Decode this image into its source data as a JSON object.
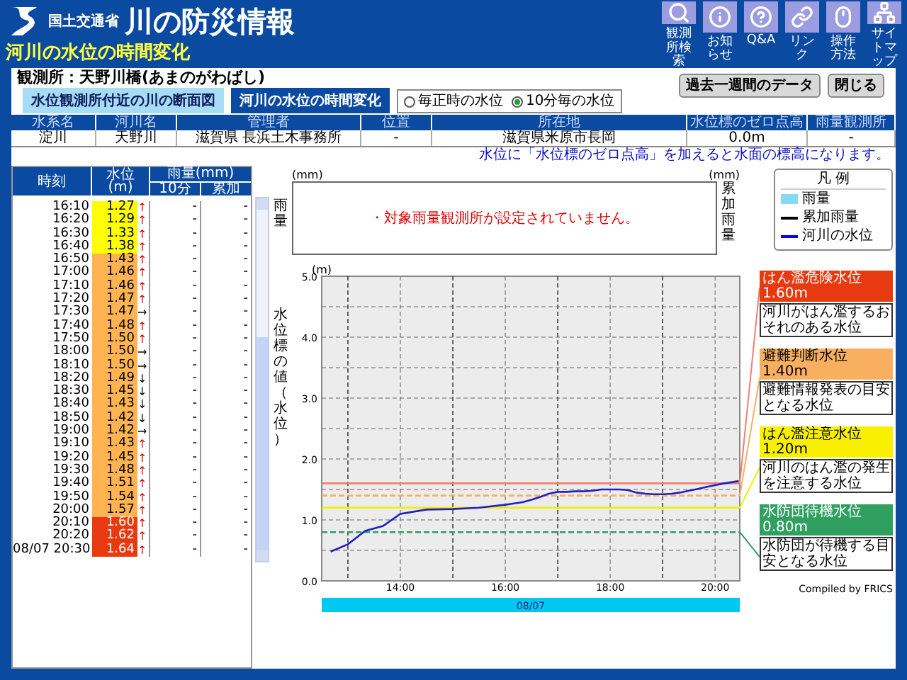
{
  "header": {
    "ministry": "国土交通省",
    "title": "川の防災情報",
    "subtitle": "河川の水位の時間変化",
    "nav": [
      {
        "label": "観測所検索",
        "kind": "search"
      },
      {
        "label": "お知らせ",
        "kind": "info"
      },
      {
        "label": "Q&A",
        "kind": "help"
      },
      {
        "label": "リンク",
        "kind": "link"
      },
      {
        "label": "操作方法",
        "kind": "mouse"
      },
      {
        "label": "サイトマップ",
        "kind": "sitemap"
      }
    ]
  },
  "station": "観測所：天野川橋(あまのがわばし)",
  "buttons": [
    "過去一週間のデータ",
    "閉じる"
  ],
  "tabs": [
    {
      "label": "水位観測所付近の川の断面図",
      "selected": false
    },
    {
      "label": "河川の水位の時間変化",
      "selected": true
    }
  ],
  "interval_options": [
    {
      "label": "毎正時の水位",
      "selected": false
    },
    {
      "label": "10分毎の水位",
      "selected": true
    }
  ],
  "info_table": {
    "columns": [
      "水系名",
      "河川名",
      "管理者",
      "位置",
      "所在地",
      "水位標のゼロ点高",
      "雨量観測所"
    ],
    "row": [
      "淀川",
      "天野川",
      "滋賀県 長浜土木事務所",
      "-",
      "滋賀県米原市長岡",
      "0.0m",
      "-"
    ]
  },
  "note": "水位に「水位標のゼロ点高」を加えると水面の標高になります。",
  "level_table": {
    "columns": {
      "time": "時刻",
      "level": "水位\n(m)",
      "rain": "雨量(mm)",
      "rain_10min": "10分",
      "rain_total": "累加"
    },
    "rows": [
      {
        "time": "16:10",
        "level": "1.27",
        "trend": "↑",
        "kind": "up",
        "color": "#ffff00",
        "rain_10min": "-",
        "rain_total": "-"
      },
      {
        "time": "16:20",
        "level": "1.29",
        "trend": "↑",
        "kind": "up",
        "color": "#ffff00",
        "rain_10min": "-",
        "rain_total": "-"
      },
      {
        "time": "16:30",
        "level": "1.33",
        "trend": "↑",
        "kind": "up",
        "color": "#ffff00",
        "rain_10min": "-",
        "rain_total": "-"
      },
      {
        "time": "16:40",
        "level": "1.38",
        "trend": "↑",
        "kind": "up",
        "color": "#ffff00",
        "rain_10min": "-",
        "rain_total": "-"
      },
      {
        "time": "16:50",
        "level": "1.43",
        "trend": "↑",
        "kind": "up",
        "color": "#ffb451",
        "rain_10min": "-",
        "rain_total": "-"
      },
      {
        "time": "17:00",
        "level": "1.46",
        "trend": "↑",
        "kind": "up",
        "color": "#ffb451",
        "rain_10min": "-",
        "rain_total": "-"
      },
      {
        "time": "17:10",
        "level": "1.46",
        "trend": "↑",
        "kind": "up",
        "color": "#ffb451",
        "rain_10min": "-",
        "rain_total": "-"
      },
      {
        "time": "17:20",
        "level": "1.47",
        "trend": "↑",
        "kind": "up",
        "color": "#ffb451",
        "rain_10min": "-",
        "rain_total": "-"
      },
      {
        "time": "17:30",
        "level": "1.47",
        "trend": "→",
        "kind": "flat",
        "color": "#ffb451",
        "rain_10min": "-",
        "rain_total": "-"
      },
      {
        "time": "17:40",
        "level": "1.48",
        "trend": "↑",
        "kind": "up",
        "color": "#ffb451",
        "rain_10min": "-",
        "rain_total": "-"
      },
      {
        "time": "17:50",
        "level": "1.50",
        "trend": "↑",
        "kind": "up",
        "color": "#ffb451",
        "rain_10min": "-",
        "rain_total": "-"
      },
      {
        "time": "18:00",
        "level": "1.50",
        "trend": "→",
        "kind": "flat",
        "color": "#ffb451",
        "rain_10min": "-",
        "rain_total": "-"
      },
      {
        "time": "18:10",
        "level": "1.50",
        "trend": "→",
        "kind": "flat",
        "color": "#ffb451",
        "rain_10min": "-",
        "rain_total": "-"
      },
      {
        "time": "18:20",
        "level": "1.49",
        "trend": "↓",
        "kind": "down",
        "color": "#ffb451",
        "rain_10min": "-",
        "rain_total": "-"
      },
      {
        "time": "18:30",
        "level": "1.45",
        "trend": "↓",
        "kind": "down",
        "color": "#ffb451",
        "rain_10min": "-",
        "rain_total": "-"
      },
      {
        "time": "18:40",
        "level": "1.43",
        "trend": "↓",
        "kind": "down",
        "color": "#ffb451",
        "rain_10min": "-",
        "rain_total": "-"
      },
      {
        "time": "18:50",
        "level": "1.42",
        "trend": "↓",
        "kind": "down",
        "color": "#ffb451",
        "rain_10min": "-",
        "rain_total": "-"
      },
      {
        "time": "19:00",
        "level": "1.42",
        "trend": "→",
        "kind": "flat",
        "color": "#ffb451",
        "rain_10min": "-",
        "rain_total": "-"
      },
      {
        "time": "19:10",
        "level": "1.43",
        "trend": "↑",
        "kind": "up",
        "color": "#ffb451",
        "rain_10min": "-",
        "rain_total": "-"
      },
      {
        "time": "19:20",
        "level": "1.45",
        "trend": "↑",
        "kind": "up",
        "color": "#ffb451",
        "rain_10min": "-",
        "rain_total": "-"
      },
      {
        "time": "19:30",
        "level": "1.48",
        "trend": "↑",
        "kind": "up",
        "color": "#ffb451",
        "rain_10min": "-",
        "rain_total": "-"
      },
      {
        "time": "19:40",
        "level": "1.51",
        "trend": "↑",
        "kind": "up",
        "color": "#ffb451",
        "rain_10min": "-",
        "rain_total": "-"
      },
      {
        "time": "19:50",
        "level": "1.54",
        "trend": "↑",
        "kind": "up",
        "color": "#ffb451",
        "rain_10min": "-",
        "rain_total": "-"
      },
      {
        "time": "20:00",
        "level": "1.57",
        "trend": "↑",
        "kind": "up",
        "color": "#ffb451",
        "rain_10min": "-",
        "rain_total": "-"
      },
      {
        "time": "20:10",
        "level": "1.60",
        "trend": "↑",
        "kind": "up",
        "color": "#e83a10",
        "rain_10min": "-",
        "rain_total": "-"
      },
      {
        "time": "20:20",
        "level": "1.62",
        "trend": "↑",
        "kind": "up",
        "color": "#e83a10",
        "rain_10min": "-",
        "rain_total": "-"
      },
      {
        "time": "08/07 20:30",
        "level": "1.64",
        "trend": "↑",
        "kind": "up",
        "color": "#e83a10",
        "rain_10min": "-",
        "rain_total": "-"
      }
    ]
  },
  "rain_chart": {
    "unit_left": "(mm)",
    "unit_right": "(mm)",
    "ylabel_left": "雨量",
    "ylabel_right": "累加雨量",
    "message": "・対象雨量観測所が設定されていません。"
  },
  "legend": {
    "title": "凡 例",
    "items": [
      {
        "label": "雨量",
        "kind": "bar",
        "color": "#88d8f8"
      },
      {
        "label": "累加雨量",
        "kind": "line",
        "color": "#000000"
      },
      {
        "label": "河川の水位",
        "kind": "line",
        "color": "#0000ff"
      }
    ]
  },
  "level_chart": {
    "unit": "(m)",
    "date_label": "08/07",
    "chart_data": {
      "type": "line",
      "ylabel": "水位標の値（水位）",
      "xlim": [
        12.5,
        20.47
      ],
      "ylim": [
        0,
        5
      ],
      "xticks": [
        {
          "value": 14,
          "label": "14:00"
        },
        {
          "value": 16,
          "label": "16:00"
        },
        {
          "value": 18,
          "label": "18:00"
        },
        {
          "value": 20,
          "label": "20:00"
        }
      ],
      "yticks": [
        {
          "value": 0,
          "label": "0.0"
        },
        {
          "value": 1,
          "label": "1.0"
        },
        {
          "value": 2,
          "label": "2.0"
        },
        {
          "value": 3,
          "label": "3.0"
        },
        {
          "value": 4,
          "label": "4.0"
        },
        {
          "value": 5,
          "label": "5.0"
        }
      ],
      "x": [
        12.67,
        13.0,
        13.33,
        13.67,
        14.0,
        14.5,
        15.0,
        15.5,
        16.0,
        16.17,
        16.33,
        16.5,
        16.67,
        16.83,
        17.0,
        17.17,
        17.33,
        17.5,
        17.67,
        17.83,
        18.0,
        18.17,
        18.33,
        18.5,
        18.67,
        18.83,
        19.0,
        19.17,
        19.33,
        19.5,
        19.67,
        19.83,
        20.0,
        20.17,
        20.33,
        20.45
      ],
      "series": [
        {
          "color": "#2020c0",
          "values": [
            0.48,
            0.6,
            0.82,
            0.9,
            1.1,
            1.17,
            1.18,
            1.2,
            1.25,
            1.27,
            1.29,
            1.33,
            1.38,
            1.43,
            1.46,
            1.46,
            1.47,
            1.47,
            1.48,
            1.5,
            1.5,
            1.5,
            1.49,
            1.45,
            1.43,
            1.42,
            1.42,
            1.43,
            1.45,
            1.48,
            1.51,
            1.54,
            1.57,
            1.6,
            1.62,
            1.64
          ]
        }
      ],
      "grid": true,
      "ref_lines": [
        {
          "axis": "y",
          "value": 1.6,
          "color": "#f08070"
        },
        {
          "axis": "y",
          "value": 1.4,
          "color": "#f8b060"
        },
        {
          "axis": "y",
          "value": 1.2,
          "color": "#f0f000"
        },
        {
          "axis": "y",
          "value": 0.8,
          "color": "#30a060"
        }
      ]
    }
  },
  "thresholds": [
    {
      "name": "はん濫危険水位",
      "value": "1.60m",
      "description": "河川がはん濫するおそれのある水位",
      "color": "#e83a10"
    },
    {
      "name": "避難判断水位",
      "value": "1.40m",
      "description": "避難情報発表の目安となる水位",
      "color": "#f8b060"
    },
    {
      "name": "はん濫注意水位",
      "value": "1.20m",
      "description": "河川のはん濫の発生を注意する水位",
      "color": "#f8f000"
    },
    {
      "name": "水防団待機水位",
      "value": "0.80m",
      "description": "水防団が待機する目安となる水位",
      "color": "#30a060"
    }
  ],
  "credit": "Compiled by FRICS"
}
